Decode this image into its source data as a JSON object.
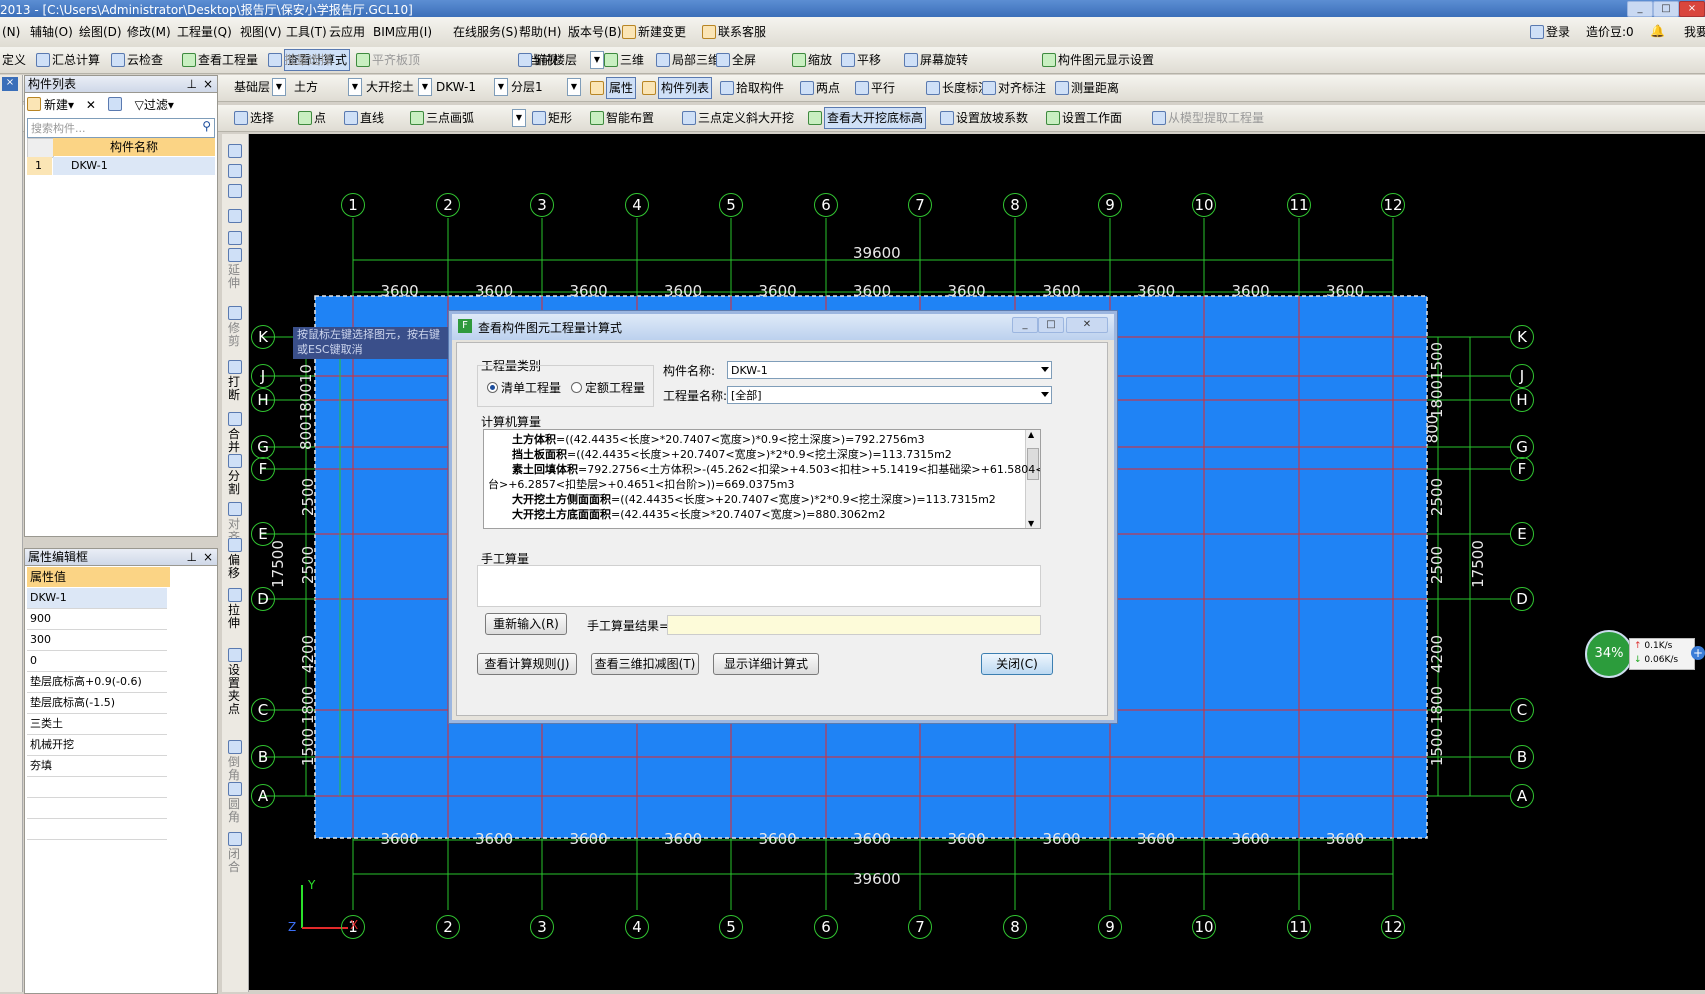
{
  "window": {
    "title": "2013 - [C:\\Users\\Administrator\\Desktop\\报告厅\\保安小学报告厅.GCL10]"
  },
  "menu": [
    "(N)",
    "辅轴(O)",
    "绘图(D)",
    "修改(M)",
    "工程量(Q)",
    "视图(V)",
    "工具(T)",
    "云应用",
    "BIM应用(I)",
    "在线服务(S)",
    "帮助(H)",
    "版本号(B)",
    "新建变更",
    "联系客服"
  ],
  "menu_right": {
    "login": "登录",
    "beans": "造价豆:0",
    "wo": "我要"
  },
  "toolbar1": [
    "定义",
    "汇总计算",
    "云检查",
    "查看工程量",
    "查看计算式",
    "批量选择",
    "平齐板顶",
    "当前楼层",
    "俯视",
    "三维",
    "局部三维",
    "全屏",
    "缩放",
    "平移",
    "屏幕旋转",
    "构件图元显示设置"
  ],
  "toolbar2": {
    "floor": "基础层",
    "type": "土方",
    "subtype": "大开挖土",
    "component": "DKW-1",
    "layer": "分层1",
    "items": [
      "属性",
      "构件列表",
      "拾取构件",
      "两点",
      "平行",
      "长度标注",
      "对齐标注",
      "测量距离"
    ]
  },
  "toolbar3": [
    "选择",
    "点",
    "直线",
    "三点画弧",
    "矩形",
    "智能布置",
    "三点定义斜大开挖",
    "查看大开挖底标高",
    "设置放坡系数",
    "设置工作面",
    "从模型提取工程量"
  ],
  "component_list": {
    "title": "构件列表",
    "new_label": "新建",
    "filter_label": "过滤",
    "search_placeholder": "搜索构件...",
    "col_header": "构件名称",
    "rows": [
      {
        "idx": "1",
        "name": "DKW-1"
      }
    ]
  },
  "property_panel": {
    "title": "属性编辑框",
    "col_header": "属性值",
    "values": [
      "DKW-1",
      "900",
      "300",
      "0",
      "垫层底标高+0.9(-0.6)",
      "垫层底标高(-1.5)",
      "三类土",
      "机械开挖",
      "夯填",
      "",
      "",
      ""
    ]
  },
  "side_tools": [
    "延伸",
    "修剪",
    "打断",
    "合并",
    "分割",
    "对齐",
    "偏移",
    "拉伸",
    "设置夹点",
    "倒角",
    "圆角",
    "闭合"
  ],
  "tooltip": [
    "按鼠标左键选择图元，按右键",
    "或ESC键取消"
  ],
  "grid": {
    "columns": [
      "1",
      "2",
      "3",
      "4",
      "5",
      "6",
      "7",
      "8",
      "9",
      "10",
      "11",
      "12"
    ],
    "rows": [
      "K",
      "J",
      "H",
      "G",
      "F",
      "E",
      "D",
      "C",
      "B",
      "A"
    ],
    "total_width": "39600",
    "span": "3600",
    "total_height": "17500",
    "left_dims": [
      "1500",
      "1800",
      "2500",
      "2500",
      "4200",
      "1800",
      "1500"
    ],
    "left_top_dims": "800180010",
    "right_dims": [
      "1500",
      "1800",
      "800",
      "2500",
      "2500",
      "4200",
      "1800",
      "1500"
    ]
  },
  "axis": {
    "x": "X",
    "y": "Y",
    "z": "Z"
  },
  "network": {
    "percent": "34%",
    "up": "0.1K/s",
    "down": "0.06K/s"
  },
  "dialog": {
    "title": "查看构件图元工程量计算式",
    "qty_type_label": "工程量类别",
    "radio_list": "清单工程量",
    "radio_quota": "定额工程量",
    "comp_name_label": "构件名称:",
    "comp_name_value": "DKW-1",
    "qty_name_label": "工程量名称:",
    "qty_name_value": "[全部]",
    "calc_label": "计算机算量",
    "lines": [
      {
        "k": "土方体积",
        "v": "=((42.4435<长度>*20.7407<宽度>)*0.9<挖土深度>)=792.2756m3"
      },
      {
        "k": "挡土板面积",
        "v": "=((42.4435<长度>+20.7407<宽度>)*2*0.9<挖土深度>)=113.7315m2"
      },
      {
        "k": "素土回填体积",
        "v": "=792.2756<土方体积>-(45.262<扣梁>+4.503<扣柱>+5.1419<扣基础梁>+61.5804<扣桩承"
      },
      {
        "k": "",
        "v": "台>+6.2857<扣垫层>+0.4651<扣台阶>))=669.0375m3"
      },
      {
        "k": "大开挖土方侧面面积",
        "v": "=((42.4435<长度>+20.7407<宽度>)*2*0.9<挖土深度>)=113.7315m2"
      },
      {
        "k": "大开挖土方底面面积",
        "v": "=(42.4435<长度>*20.7407<宽度>)=880.3062m2"
      }
    ],
    "manual_label": "手工算量",
    "reinput_button": "重新输入(R)",
    "manual_result_label": "手工算量结果=",
    "rule_button": "查看计算规则(J)",
    "view3d_button": "查看三维扣减图(T)",
    "detail_button": "显示详细计算式",
    "close_button": "关闭(C)"
  }
}
